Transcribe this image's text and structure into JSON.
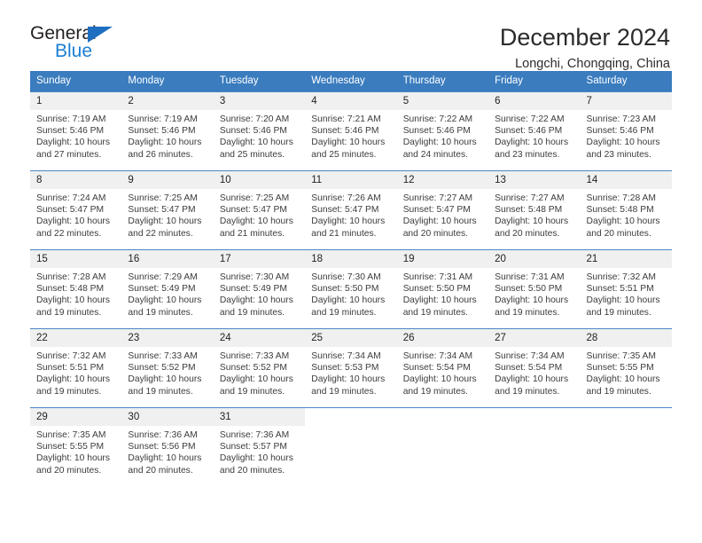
{
  "brand": {
    "name_part1": "General",
    "name_part2": "Blue",
    "triangle_color": "#1f6fc0",
    "blue_color": "#1a7fd4"
  },
  "header": {
    "title": "December 2024",
    "subtitle": "Longchi, Chongqing, China"
  },
  "theme": {
    "header_row_bg": "#3a7cbe",
    "header_row_text": "#ffffff",
    "daynum_bg": "#f0f0f0",
    "row_divider": "#4a86c5",
    "page_bg": "#ffffff",
    "body_text": "#3c3c3c"
  },
  "weekday_headers": [
    "Sunday",
    "Monday",
    "Tuesday",
    "Wednesday",
    "Thursday",
    "Friday",
    "Saturday"
  ],
  "weeks": [
    [
      {
        "day": "1",
        "sunrise": "Sunrise: 7:19 AM",
        "sunset": "Sunset: 5:46 PM",
        "daylight_line1": "Daylight: 10 hours",
        "daylight_line2": "and 27 minutes."
      },
      {
        "day": "2",
        "sunrise": "Sunrise: 7:19 AM",
        "sunset": "Sunset: 5:46 PM",
        "daylight_line1": "Daylight: 10 hours",
        "daylight_line2": "and 26 minutes."
      },
      {
        "day": "3",
        "sunrise": "Sunrise: 7:20 AM",
        "sunset": "Sunset: 5:46 PM",
        "daylight_line1": "Daylight: 10 hours",
        "daylight_line2": "and 25 minutes."
      },
      {
        "day": "4",
        "sunrise": "Sunrise: 7:21 AM",
        "sunset": "Sunset: 5:46 PM",
        "daylight_line1": "Daylight: 10 hours",
        "daylight_line2": "and 25 minutes."
      },
      {
        "day": "5",
        "sunrise": "Sunrise: 7:22 AM",
        "sunset": "Sunset: 5:46 PM",
        "daylight_line1": "Daylight: 10 hours",
        "daylight_line2": "and 24 minutes."
      },
      {
        "day": "6",
        "sunrise": "Sunrise: 7:22 AM",
        "sunset": "Sunset: 5:46 PM",
        "daylight_line1": "Daylight: 10 hours",
        "daylight_line2": "and 23 minutes."
      },
      {
        "day": "7",
        "sunrise": "Sunrise: 7:23 AM",
        "sunset": "Sunset: 5:46 PM",
        "daylight_line1": "Daylight: 10 hours",
        "daylight_line2": "and 23 minutes."
      }
    ],
    [
      {
        "day": "8",
        "sunrise": "Sunrise: 7:24 AM",
        "sunset": "Sunset: 5:47 PM",
        "daylight_line1": "Daylight: 10 hours",
        "daylight_line2": "and 22 minutes."
      },
      {
        "day": "9",
        "sunrise": "Sunrise: 7:25 AM",
        "sunset": "Sunset: 5:47 PM",
        "daylight_line1": "Daylight: 10 hours",
        "daylight_line2": "and 22 minutes."
      },
      {
        "day": "10",
        "sunrise": "Sunrise: 7:25 AM",
        "sunset": "Sunset: 5:47 PM",
        "daylight_line1": "Daylight: 10 hours",
        "daylight_line2": "and 21 minutes."
      },
      {
        "day": "11",
        "sunrise": "Sunrise: 7:26 AM",
        "sunset": "Sunset: 5:47 PM",
        "daylight_line1": "Daylight: 10 hours",
        "daylight_line2": "and 21 minutes."
      },
      {
        "day": "12",
        "sunrise": "Sunrise: 7:27 AM",
        "sunset": "Sunset: 5:47 PM",
        "daylight_line1": "Daylight: 10 hours",
        "daylight_line2": "and 20 minutes."
      },
      {
        "day": "13",
        "sunrise": "Sunrise: 7:27 AM",
        "sunset": "Sunset: 5:48 PM",
        "daylight_line1": "Daylight: 10 hours",
        "daylight_line2": "and 20 minutes."
      },
      {
        "day": "14",
        "sunrise": "Sunrise: 7:28 AM",
        "sunset": "Sunset: 5:48 PM",
        "daylight_line1": "Daylight: 10 hours",
        "daylight_line2": "and 20 minutes."
      }
    ],
    [
      {
        "day": "15",
        "sunrise": "Sunrise: 7:28 AM",
        "sunset": "Sunset: 5:48 PM",
        "daylight_line1": "Daylight: 10 hours",
        "daylight_line2": "and 19 minutes."
      },
      {
        "day": "16",
        "sunrise": "Sunrise: 7:29 AM",
        "sunset": "Sunset: 5:49 PM",
        "daylight_line1": "Daylight: 10 hours",
        "daylight_line2": "and 19 minutes."
      },
      {
        "day": "17",
        "sunrise": "Sunrise: 7:30 AM",
        "sunset": "Sunset: 5:49 PM",
        "daylight_line1": "Daylight: 10 hours",
        "daylight_line2": "and 19 minutes."
      },
      {
        "day": "18",
        "sunrise": "Sunrise: 7:30 AM",
        "sunset": "Sunset: 5:50 PM",
        "daylight_line1": "Daylight: 10 hours",
        "daylight_line2": "and 19 minutes."
      },
      {
        "day": "19",
        "sunrise": "Sunrise: 7:31 AM",
        "sunset": "Sunset: 5:50 PM",
        "daylight_line1": "Daylight: 10 hours",
        "daylight_line2": "and 19 minutes."
      },
      {
        "day": "20",
        "sunrise": "Sunrise: 7:31 AM",
        "sunset": "Sunset: 5:50 PM",
        "daylight_line1": "Daylight: 10 hours",
        "daylight_line2": "and 19 minutes."
      },
      {
        "day": "21",
        "sunrise": "Sunrise: 7:32 AM",
        "sunset": "Sunset: 5:51 PM",
        "daylight_line1": "Daylight: 10 hours",
        "daylight_line2": "and 19 minutes."
      }
    ],
    [
      {
        "day": "22",
        "sunrise": "Sunrise: 7:32 AM",
        "sunset": "Sunset: 5:51 PM",
        "daylight_line1": "Daylight: 10 hours",
        "daylight_line2": "and 19 minutes."
      },
      {
        "day": "23",
        "sunrise": "Sunrise: 7:33 AM",
        "sunset": "Sunset: 5:52 PM",
        "daylight_line1": "Daylight: 10 hours",
        "daylight_line2": "and 19 minutes."
      },
      {
        "day": "24",
        "sunrise": "Sunrise: 7:33 AM",
        "sunset": "Sunset: 5:52 PM",
        "daylight_line1": "Daylight: 10 hours",
        "daylight_line2": "and 19 minutes."
      },
      {
        "day": "25",
        "sunrise": "Sunrise: 7:34 AM",
        "sunset": "Sunset: 5:53 PM",
        "daylight_line1": "Daylight: 10 hours",
        "daylight_line2": "and 19 minutes."
      },
      {
        "day": "26",
        "sunrise": "Sunrise: 7:34 AM",
        "sunset": "Sunset: 5:54 PM",
        "daylight_line1": "Daylight: 10 hours",
        "daylight_line2": "and 19 minutes."
      },
      {
        "day": "27",
        "sunrise": "Sunrise: 7:34 AM",
        "sunset": "Sunset: 5:54 PM",
        "daylight_line1": "Daylight: 10 hours",
        "daylight_line2": "and 19 minutes."
      },
      {
        "day": "28",
        "sunrise": "Sunrise: 7:35 AM",
        "sunset": "Sunset: 5:55 PM",
        "daylight_line1": "Daylight: 10 hours",
        "daylight_line2": "and 19 minutes."
      }
    ],
    [
      {
        "day": "29",
        "sunrise": "Sunrise: 7:35 AM",
        "sunset": "Sunset: 5:55 PM",
        "daylight_line1": "Daylight: 10 hours",
        "daylight_line2": "and 20 minutes."
      },
      {
        "day": "30",
        "sunrise": "Sunrise: 7:36 AM",
        "sunset": "Sunset: 5:56 PM",
        "daylight_line1": "Daylight: 10 hours",
        "daylight_line2": "and 20 minutes."
      },
      {
        "day": "31",
        "sunrise": "Sunrise: 7:36 AM",
        "sunset": "Sunset: 5:57 PM",
        "daylight_line1": "Daylight: 10 hours",
        "daylight_line2": "and 20 minutes."
      },
      {
        "day": "",
        "sunrise": "",
        "sunset": "",
        "daylight_line1": "",
        "daylight_line2": ""
      },
      {
        "day": "",
        "sunrise": "",
        "sunset": "",
        "daylight_line1": "",
        "daylight_line2": ""
      },
      {
        "day": "",
        "sunrise": "",
        "sunset": "",
        "daylight_line1": "",
        "daylight_line2": ""
      },
      {
        "day": "",
        "sunrise": "",
        "sunset": "",
        "daylight_line1": "",
        "daylight_line2": ""
      }
    ]
  ]
}
